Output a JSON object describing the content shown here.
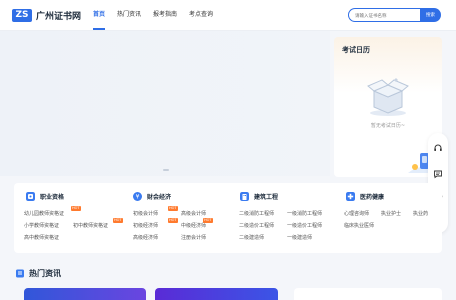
{
  "header": {
    "logo_mark": "ZS",
    "site_name": "广州证书网",
    "nav": [
      "首页",
      "热门资讯",
      "报考指南",
      "考点查询"
    ],
    "search_placeholder": "请输入证书名称",
    "search_button": "搜索",
    "brand_color": "#2f6ee6"
  },
  "calendar": {
    "title": "考试日历",
    "empty_text": "暂无考试日历~"
  },
  "side_tools": [
    "headset-icon",
    "message-icon",
    "chat-icon",
    "back-to-top-icon"
  ],
  "categories": [
    {
      "title": "职业资格",
      "icon_color": "#3a7bf0",
      "links": [
        "幼儿园教师资格证",
        "小学教师资格证",
        "初中教师资格证",
        "高中教师资格证"
      ],
      "hot_label": "HOT"
    },
    {
      "title": "财会经济",
      "icon_color": "#3a7bf0",
      "links": [
        "初级会计师",
        "高级会计师",
        "初级经济师",
        "中级经济师",
        "高级经济师",
        "注册会计师"
      ],
      "hot_label": "HOT"
    },
    {
      "title": "建筑工程",
      "icon_color": "#3a7bf0",
      "links": [
        "二级消防工程师",
        "一级消防工程师",
        "二级造价工程师",
        "一级造价工程师",
        "二级建造师",
        "一级建造师"
      ]
    },
    {
      "title": "医药健康",
      "icon_color": "#3a7bf0",
      "links": [
        "心理咨询师",
        "执业护士",
        "执业药",
        "临床执业医师"
      ]
    }
  ],
  "section": {
    "title": "热门资讯"
  }
}
